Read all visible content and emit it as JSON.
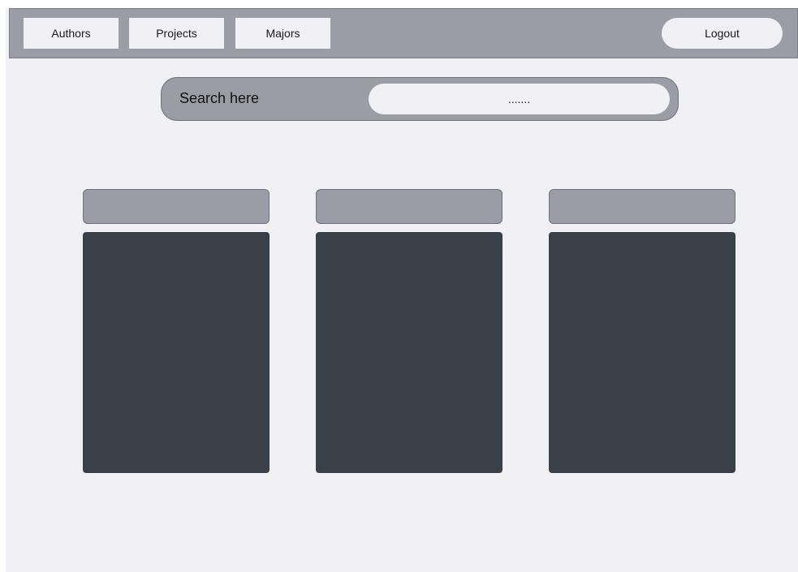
{
  "nav": {
    "items": [
      {
        "label": "Authors"
      },
      {
        "label": "Projects"
      },
      {
        "label": "Majors"
      }
    ],
    "logout_label": "Logout"
  },
  "search": {
    "label": "Search here",
    "value": "......."
  },
  "cards": [
    {
      "header": ""
    },
    {
      "header": ""
    },
    {
      "header": ""
    }
  ],
  "colors": {
    "background": "#f0f0f5",
    "bar": "#9a9da6",
    "card_body": "#394047"
  }
}
